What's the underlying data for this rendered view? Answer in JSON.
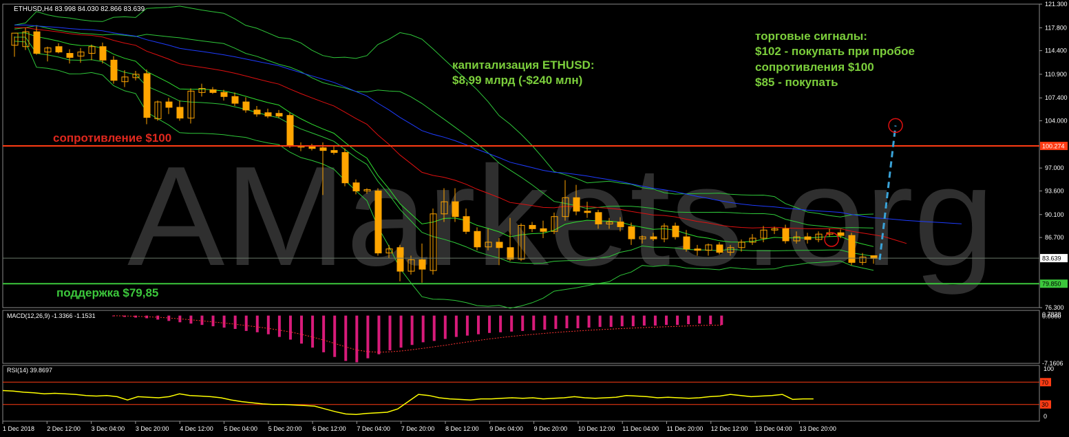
{
  "main_info": "ETHUSD,H4  83.998 84.030 82.866 83.639",
  "watermark": "AMarkets.org",
  "annotations": {
    "cap_line1": "капитализация ETHUSD:",
    "cap_line2": "$8,99 млрд (-$240 млн)",
    "sig_line1": "торговые сигналы:",
    "sig_line2": "$102 - покупать при пробое",
    "sig_line3": "сопротивления $100",
    "sig_line4": "$85 - покупать",
    "resistance": "сопротивление $100",
    "support": "поддержка $79,85"
  },
  "colors": {
    "candle": "#ffa500",
    "resistance": "#ff3c14",
    "support": "#3cc83c",
    "text_green": "#7ccf3c",
    "text_red": "#e0281e",
    "macd": "#d81b7a",
    "rsi": "#ffff00",
    "ma_blue": "#1e3cff",
    "ma_red": "#e01010",
    "bands": "#2fc83a",
    "forecast": "#3aa3d8"
  },
  "chart_data": [
    {
      "type": "candlestick",
      "symbol": "ETHUSD",
      "timeframe": "H4",
      "ylim": [
        76.3,
        121.3
      ],
      "yticks": [
        "121.300",
        "117.800",
        "114.400",
        "110.900",
        "107.400",
        "104.000",
        "100.274",
        "97.000",
        "93.600",
        "90.100",
        "86.700",
        "83.639",
        "79.850",
        "76.300"
      ],
      "last_price": "83.639",
      "resistance_level": "100.274",
      "support_level": "79.850",
      "xticks": [
        "1 Dec 2018",
        "2 Dec 12:00",
        "3 Dec 04:00",
        "3 Dec 20:00",
        "4 Dec 12:00",
        "5 Dec 04:00",
        "5 Dec 20:00",
        "6 Dec 12:00",
        "7 Dec 04:00",
        "7 Dec 20:00",
        "8 Dec 12:00",
        "9 Dec 04:00",
        "9 Dec 20:00",
        "10 Dec 12:00",
        "11 Dec 04:00",
        "11 Dec 20:00",
        "12 Dec 12:00",
        "13 Dec 04:00",
        "13 Dec 20:00"
      ],
      "candles": [
        {
          "o": 115.2,
          "h": 116.5,
          "l": 113.5,
          "c": 117.0
        },
        {
          "o": 115.0,
          "h": 117.8,
          "l": 114.5,
          "c": 117.2
        },
        {
          "o": 117.2,
          "h": 118.0,
          "l": 113.8,
          "c": 114.0
        },
        {
          "o": 114.2,
          "h": 115.0,
          "l": 112.8,
          "c": 114.8
        },
        {
          "o": 115.0,
          "h": 115.5,
          "l": 114.0,
          "c": 114.2
        },
        {
          "o": 114.0,
          "h": 114.6,
          "l": 112.5,
          "c": 113.4
        },
        {
          "o": 113.6,
          "h": 114.8,
          "l": 112.6,
          "c": 114.2
        },
        {
          "o": 114.0,
          "h": 115.3,
          "l": 113.0,
          "c": 115.0
        },
        {
          "o": 115.0,
          "h": 115.6,
          "l": 112.5,
          "c": 113.0
        },
        {
          "o": 113.0,
          "h": 113.6,
          "l": 109.5,
          "c": 110.0
        },
        {
          "o": 109.8,
          "h": 111.5,
          "l": 109.0,
          "c": 110.5
        },
        {
          "o": 110.4,
          "h": 111.4,
          "l": 110.0,
          "c": 110.9
        },
        {
          "o": 111.0,
          "h": 111.6,
          "l": 103.5,
          "c": 104.5
        },
        {
          "o": 104.3,
          "h": 107.0,
          "l": 104.0,
          "c": 106.8
        },
        {
          "o": 106.8,
          "h": 107.4,
          "l": 105.0,
          "c": 106.0
        },
        {
          "o": 106.0,
          "h": 107.0,
          "l": 104.0,
          "c": 104.4
        },
        {
          "o": 104.4,
          "h": 108.8,
          "l": 103.6,
          "c": 108.4
        },
        {
          "o": 108.2,
          "h": 109.5,
          "l": 107.6,
          "c": 108.8
        },
        {
          "o": 108.6,
          "h": 109.0,
          "l": 108.0,
          "c": 108.2
        },
        {
          "o": 108.2,
          "h": 108.6,
          "l": 107.0,
          "c": 107.6
        },
        {
          "o": 107.6,
          "h": 108.2,
          "l": 106.2,
          "c": 106.6
        },
        {
          "o": 106.8,
          "h": 107.5,
          "l": 105.2,
          "c": 105.6
        },
        {
          "o": 105.6,
          "h": 106.2,
          "l": 104.6,
          "c": 105.0
        },
        {
          "o": 105.2,
          "h": 105.8,
          "l": 104.4,
          "c": 104.7
        },
        {
          "o": 105.1,
          "h": 105.6,
          "l": 104.4,
          "c": 104.7
        },
        {
          "o": 104.8,
          "h": 105.2,
          "l": 100.0,
          "c": 100.3
        },
        {
          "o": 100.3,
          "h": 100.8,
          "l": 99.5,
          "c": 100.1
        },
        {
          "o": 100.2,
          "h": 100.6,
          "l": 99.6,
          "c": 99.9
        },
        {
          "o": 100.0,
          "h": 100.8,
          "l": 93.0,
          "c": 99.6
        },
        {
          "o": 99.6,
          "h": 100.4,
          "l": 99.0,
          "c": 99.3
        },
        {
          "o": 99.3,
          "h": 99.9,
          "l": 94.3,
          "c": 94.8
        },
        {
          "o": 94.8,
          "h": 95.3,
          "l": 93.1,
          "c": 93.6
        },
        {
          "o": 93.6,
          "h": 94.0,
          "l": 93.2,
          "c": 93.8
        },
        {
          "o": 93.6,
          "h": 94.0,
          "l": 84.0,
          "c": 84.4
        },
        {
          "o": 84.4,
          "h": 85.6,
          "l": 83.6,
          "c": 85.0
        },
        {
          "o": 85.2,
          "h": 85.6,
          "l": 80.2,
          "c": 81.7
        },
        {
          "o": 81.7,
          "h": 84.0,
          "l": 81.2,
          "c": 83.4
        },
        {
          "o": 83.4,
          "h": 85.8,
          "l": 80.0,
          "c": 82.0
        },
        {
          "o": 81.8,
          "h": 91.0,
          "l": 81.2,
          "c": 90.2
        },
        {
          "o": 90.2,
          "h": 94.0,
          "l": 89.0,
          "c": 92.0
        },
        {
          "o": 92.0,
          "h": 94.0,
          "l": 89.0,
          "c": 89.8
        },
        {
          "o": 89.8,
          "h": 91.0,
          "l": 87.2,
          "c": 87.6
        },
        {
          "o": 87.6,
          "h": 88.2,
          "l": 84.8,
          "c": 85.3
        },
        {
          "o": 85.3,
          "h": 88.0,
          "l": 84.8,
          "c": 86.0
        },
        {
          "o": 86.0,
          "h": 86.6,
          "l": 82.6,
          "c": 85.2
        },
        {
          "o": 85.2,
          "h": 89.6,
          "l": 83.2,
          "c": 83.5
        },
        {
          "o": 83.5,
          "h": 88.8,
          "l": 83.2,
          "c": 88.5
        },
        {
          "o": 88.5,
          "h": 89.0,
          "l": 87.5,
          "c": 88.0
        },
        {
          "o": 88.0,
          "h": 89.2,
          "l": 86.6,
          "c": 87.6
        },
        {
          "o": 87.6,
          "h": 90.4,
          "l": 87.2,
          "c": 89.8
        },
        {
          "o": 89.8,
          "h": 95.2,
          "l": 89.2,
          "c": 92.6
        },
        {
          "o": 92.6,
          "h": 94.5,
          "l": 90.0,
          "c": 90.6
        },
        {
          "o": 90.6,
          "h": 92.0,
          "l": 89.6,
          "c": 90.4
        },
        {
          "o": 90.4,
          "h": 90.8,
          "l": 88.0,
          "c": 88.7
        },
        {
          "o": 88.7,
          "h": 89.6,
          "l": 88.0,
          "c": 89.0
        },
        {
          "o": 89.0,
          "h": 89.7,
          "l": 87.6,
          "c": 88.3
        },
        {
          "o": 88.3,
          "h": 88.9,
          "l": 85.6,
          "c": 86.5
        },
        {
          "o": 86.5,
          "h": 87.0,
          "l": 85.8,
          "c": 86.8
        },
        {
          "o": 86.8,
          "h": 87.4,
          "l": 86.2,
          "c": 86.5
        },
        {
          "o": 86.5,
          "h": 88.8,
          "l": 86.0,
          "c": 88.4
        },
        {
          "o": 88.4,
          "h": 88.9,
          "l": 86.4,
          "c": 86.8
        },
        {
          "o": 86.8,
          "h": 87.8,
          "l": 84.6,
          "c": 85.0
        },
        {
          "o": 85.0,
          "h": 85.6,
          "l": 84.0,
          "c": 84.8
        },
        {
          "o": 84.8,
          "h": 85.8,
          "l": 84.0,
          "c": 85.6
        },
        {
          "o": 85.6,
          "h": 86.0,
          "l": 84.2,
          "c": 84.5
        },
        {
          "o": 84.5,
          "h": 85.6,
          "l": 84.0,
          "c": 85.2
        },
        {
          "o": 85.2,
          "h": 86.4,
          "l": 84.6,
          "c": 86.0
        },
        {
          "o": 86.0,
          "h": 87.2,
          "l": 85.6,
          "c": 86.6
        },
        {
          "o": 86.6,
          "h": 88.4,
          "l": 86.0,
          "c": 87.8
        },
        {
          "o": 87.8,
          "h": 88.3,
          "l": 87.2,
          "c": 88.0
        },
        {
          "o": 88.0,
          "h": 88.6,
          "l": 85.8,
          "c": 86.2
        },
        {
          "o": 86.2,
          "h": 87.6,
          "l": 85.8,
          "c": 86.8
        },
        {
          "o": 86.8,
          "h": 87.4,
          "l": 85.8,
          "c": 86.4
        },
        {
          "o": 86.4,
          "h": 87.6,
          "l": 86.0,
          "c": 87.2
        },
        {
          "o": 87.2,
          "h": 88.0,
          "l": 86.8,
          "c": 87.4
        },
        {
          "o": 87.4,
          "h": 87.9,
          "l": 86.6,
          "c": 87.0
        },
        {
          "o": 87.0,
          "h": 87.4,
          "l": 82.6,
          "c": 83.0
        },
        {
          "o": 83.0,
          "h": 84.4,
          "l": 82.6,
          "c": 83.8
        },
        {
          "o": 84.0,
          "h": 84.0,
          "l": 82.8,
          "c": 83.6
        }
      ]
    },
    {
      "type": "histogram",
      "indicator": "MACD(12,26,9)",
      "label": "MACD(12,26,9) -1.3366 -1.1531",
      "yticks": [
        "0.0000",
        "0.7828",
        "-7.1606"
      ],
      "ylim": [
        -7.1606,
        0.7828
      ],
      "values": [
        -0.1,
        -0.2,
        -0.3,
        -0.4,
        -0.6,
        -0.8,
        -1.0,
        -1.2,
        -1.4,
        -1.6,
        -1.8,
        -2.0,
        -2.3,
        -2.5,
        -2.8,
        -3.2,
        -3.6,
        -4.2,
        -4.8,
        -5.5,
        -6.2,
        -6.8,
        -7.0,
        -6.4,
        -5.8,
        -5.2,
        -4.8,
        -4.4,
        -4.0,
        -3.8,
        -3.5,
        -3.2,
        -3.0,
        -2.8,
        -2.6,
        -2.5,
        -2.4,
        -2.3,
        -2.2,
        -2.1,
        -2.0,
        -1.9,
        -1.9,
        -1.8,
        -1.7,
        -1.7,
        -1.6,
        -1.6,
        -1.5,
        -1.5,
        -1.4,
        -1.4,
        -1.3,
        -1.2,
        -1.3,
        -1.4
      ]
    },
    {
      "type": "line",
      "indicator": "RSI(14)",
      "label": "RSI(14) 39.8697",
      "ylim": [
        0,
        100
      ],
      "yticks": [
        "100",
        "70",
        "30",
        "0"
      ],
      "levels": [
        70,
        30
      ],
      "values": [
        55,
        54,
        52,
        51,
        49,
        50,
        49,
        48,
        46,
        45,
        46,
        44,
        38,
        44,
        43,
        42,
        44,
        49,
        46,
        45,
        44,
        42,
        38,
        35,
        33,
        31,
        30,
        30,
        29,
        28,
        27,
        22,
        17,
        13,
        12,
        14,
        15,
        16,
        22,
        35,
        48,
        46,
        42,
        40,
        39,
        38,
        40,
        40,
        41,
        42,
        41,
        42,
        40,
        41,
        42,
        44,
        42,
        41,
        42,
        43,
        46,
        45,
        44,
        42,
        43,
        42,
        41,
        42,
        44,
        45,
        48,
        46,
        44,
        45,
        46,
        48,
        39,
        40,
        40
      ]
    }
  ]
}
